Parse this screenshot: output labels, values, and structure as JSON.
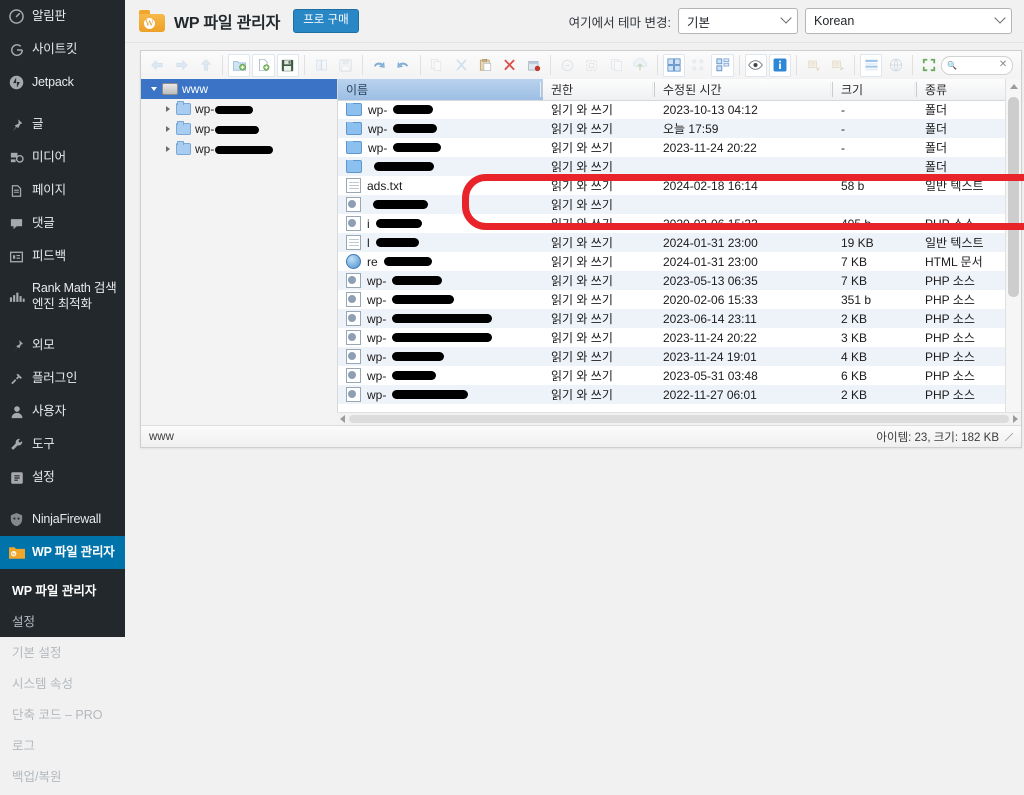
{
  "sidebar": {
    "items": [
      {
        "label": "알림판",
        "icon": "dashboard-icon",
        "key": "dashboard"
      },
      {
        "label": "사이트킷",
        "icon": "google-g-icon",
        "key": "site-kit"
      },
      {
        "label": "Jetpack",
        "icon": "jetpack-icon",
        "key": "jetpack"
      },
      {
        "label": "글",
        "icon": "pin-icon",
        "key": "posts"
      },
      {
        "label": "미디어",
        "icon": "media-icon",
        "key": "media"
      },
      {
        "label": "페이지",
        "icon": "page-icon",
        "key": "pages"
      },
      {
        "label": "댓글",
        "icon": "comment-icon",
        "key": "comments"
      },
      {
        "label": "피드백",
        "icon": "feedback-icon",
        "key": "feedback"
      },
      {
        "label": "Rank Math 검색엔진 최적화",
        "icon": "rankmath-icon",
        "key": "rank-math"
      },
      {
        "label": "외모",
        "icon": "appearance-icon",
        "key": "appearance"
      },
      {
        "label": "플러그인",
        "icon": "plugin-icon",
        "key": "plugins"
      },
      {
        "label": "사용자",
        "icon": "user-icon",
        "key": "users"
      },
      {
        "label": "도구",
        "icon": "tools-icon",
        "key": "tools"
      },
      {
        "label": "설정",
        "icon": "settings-icon",
        "key": "settings"
      },
      {
        "label": "NinjaFirewall",
        "icon": "ninjafirewall-icon",
        "key": "ninjafirewall"
      },
      {
        "label": "WP 파일 관리자",
        "icon": "wp-file-manager-icon",
        "key": "wp-file-manager",
        "current": true
      }
    ],
    "submenu": [
      {
        "label": "WP 파일 관리자",
        "head": true
      },
      {
        "label": "설정"
      },
      {
        "label": "기본 설정"
      },
      {
        "label": "시스템 속성"
      },
      {
        "label": "단축 코드 – PRO"
      },
      {
        "label": "로그"
      },
      {
        "label": "백업/복원"
      }
    ]
  },
  "header": {
    "title": "WP 파일 관리자",
    "pro_button": "프로 구매",
    "theme_label": "여기에서 테마 변경:",
    "theme_value": "기본",
    "language_value": "Korean"
  },
  "toolbar": {
    "icons": [
      {
        "name": "back-icon",
        "dim": true
      },
      {
        "name": "forward-icon",
        "dim": true
      },
      {
        "name": "up-icon",
        "dim": true
      },
      {
        "name": "new-folder-icon",
        "dim": false
      },
      {
        "name": "new-file-icon",
        "dim": false
      },
      {
        "name": "save-icon",
        "dim": false
      },
      {
        "name": "open-icon",
        "dim": true
      },
      {
        "name": "download-icon",
        "dim": true
      },
      {
        "name": "undo-icon",
        "dim": false
      },
      {
        "name": "redo-icon",
        "dim": false
      },
      {
        "name": "copy-icon",
        "dim": true
      },
      {
        "name": "cut-icon",
        "dim": true
      },
      {
        "name": "paste-icon",
        "dim": false
      },
      {
        "name": "delete-icon",
        "dim": false
      },
      {
        "name": "archive-icon",
        "dim": false
      },
      {
        "name": "rename-icon",
        "dim": true
      },
      {
        "name": "resize-icon",
        "dim": true
      },
      {
        "name": "duplicate-icon",
        "dim": true
      },
      {
        "name": "upload-icon",
        "dim": true
      },
      {
        "name": "view-grid-icon",
        "dim": false
      },
      {
        "name": "view-icons-icon",
        "dim": false
      },
      {
        "name": "view-list-icon",
        "dim": true
      },
      {
        "name": "view-tiles-icon",
        "dim": false
      },
      {
        "name": "preview-icon",
        "dim": false
      },
      {
        "name": "info-icon",
        "dim": false
      },
      {
        "name": "select-all-icon",
        "dim": true
      },
      {
        "name": "select-invert-icon",
        "dim": true
      },
      {
        "name": "sort-icon",
        "dim": false
      },
      {
        "name": "search-web-icon",
        "dim": true
      },
      {
        "name": "fullscreen-icon",
        "dim": false
      }
    ],
    "search_placeholder": ""
  },
  "tree": {
    "root": {
      "label": "www",
      "icon": "drive-icon"
    },
    "children": [
      {
        "label": "wp-",
        "redact_width": 38
      },
      {
        "label": "wp-",
        "redact_width": 44
      },
      {
        "label": "wp-",
        "redact_width": 58
      }
    ]
  },
  "file_list": {
    "columns": [
      {
        "label": "이름",
        "key": "name",
        "sorted": true
      },
      {
        "label": "권한",
        "key": "permission"
      },
      {
        "label": "수정된 시간",
        "key": "modified"
      },
      {
        "label": "크기",
        "key": "size"
      },
      {
        "label": "종류",
        "key": "kind"
      }
    ],
    "rows": [
      {
        "name": "wp-",
        "redact": 40,
        "icon": "folder",
        "permission": "읽기 와 쓰기",
        "modified": "2023-10-13 04:12",
        "size": "-",
        "kind": "폴더"
      },
      {
        "name": "wp-",
        "redact": 44,
        "icon": "folder",
        "permission": "읽기 와 쓰기",
        "modified": "오늘 17:59",
        "size": "-",
        "kind": "폴더"
      },
      {
        "name": "wp-",
        "redact": 48,
        "icon": "folder",
        "permission": "읽기 와 쓰기",
        "modified": "2023-11-24 20:22",
        "size": "-",
        "kind": "폴더"
      },
      {
        "name": "",
        "redact": 60,
        "icon": "folder",
        "permission": "읽기 와 쓰기",
        "modified": "",
        "size": "",
        "kind": "폴더",
        "obscured": true
      },
      {
        "name": "ads.txt",
        "redact": 0,
        "icon": "txt",
        "permission": "읽기 와 쓰기",
        "modified": "2024-02-18 16:14",
        "size": "58 b",
        "kind": "일반 텍스트",
        "highlighted": true
      },
      {
        "name": "",
        "redact": 55,
        "icon": "php",
        "permission": "읽기 와 쓰기",
        "modified": "",
        "size": "",
        "kind": "",
        "obscured": true
      },
      {
        "name": "i",
        "redact": 46,
        "icon": "php",
        "permission": "읽기 와 쓰기",
        "modified": "2020-02-06 15:33",
        "size": "405 b",
        "kind": "PHP 소스"
      },
      {
        "name": "l",
        "redact": 43,
        "icon": "txt",
        "permission": "읽기 와 쓰기",
        "modified": "2024-01-31 23:00",
        "size": "19 KB",
        "kind": "일반 텍스트"
      },
      {
        "name": "re",
        "redact": 48,
        "icon": "html",
        "permission": "읽기 와 쓰기",
        "modified": "2024-01-31 23:00",
        "size": "7 KB",
        "kind": "HTML 문서"
      },
      {
        "name": "wp-",
        "redact": 50,
        "icon": "php",
        "permission": "읽기 와 쓰기",
        "modified": "2023-05-13 06:35",
        "size": "7 KB",
        "kind": "PHP 소스"
      },
      {
        "name": "wp-",
        "redact": 62,
        "icon": "php",
        "permission": "읽기 와 쓰기",
        "modified": "2020-02-06 15:33",
        "size": "351 b",
        "kind": "PHP 소스"
      },
      {
        "name": "wp-",
        "redact": 100,
        "icon": "php",
        "permission": "읽기 와 쓰기",
        "modified": "2023-06-14 23:11",
        "size": "2 KB",
        "kind": "PHP 소스"
      },
      {
        "name": "wp-",
        "redact": 100,
        "icon": "php",
        "permission": "읽기 와 쓰기",
        "modified": "2023-11-24 20:22",
        "size": "3 KB",
        "kind": "PHP 소스"
      },
      {
        "name": "wp-",
        "redact": 52,
        "icon": "php",
        "permission": "읽기 와 쓰기",
        "modified": "2023-11-24 19:01",
        "size": "4 KB",
        "kind": "PHP 소스"
      },
      {
        "name": "wp-",
        "redact": 44,
        "icon": "php",
        "permission": "읽기 와 쓰기",
        "modified": "2023-05-31 03:48",
        "size": "6 KB",
        "kind": "PHP 소스"
      },
      {
        "name": "wp-",
        "redact": 76,
        "icon": "php",
        "permission": "읽기 와 쓰기",
        "modified": "2022-11-27 06:01",
        "size": "2 KB",
        "kind": "PHP 소스"
      }
    ]
  },
  "status_bar": {
    "path": "www",
    "summary": "아이템: 23, 크기: 182 KB"
  },
  "colors": {
    "accent": "#0073aa",
    "sidebar_bg": "#23282d",
    "annotation_red": "#e8232a",
    "tree_selected": "#3b74c6",
    "pro_button": "#2a87c6"
  }
}
